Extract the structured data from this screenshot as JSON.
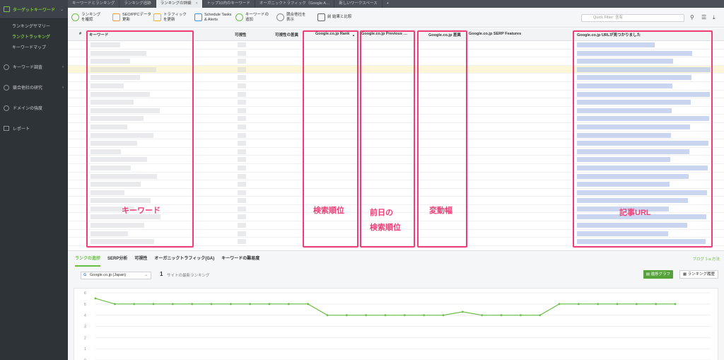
{
  "sidebar": {
    "section_label": "ターゲットキーワード",
    "sub_items": [
      "ランキングサマリー",
      "ランクトラッキング",
      "キーワードマップ"
    ],
    "active_sub": 1,
    "items": [
      "キーワード調査",
      "競合他社の研究",
      "ドメインの強度",
      "レポート"
    ]
  },
  "tabs": [
    "キーワードとランキング",
    "ランキング追跡",
    "ランキングの詳細",
    "トップ10内のキーワード",
    "オーガニックトラフィック（Google A…",
    "新しいワークスペース"
  ],
  "active_tab": 2,
  "toolbar": {
    "buttons": [
      "ランキング\nを確認",
      "SEO/PPCデータ\n更新",
      "トラフィック\nを更新",
      "Schedule Tasks\n& Alerts",
      "キーワードの\n追加",
      "競合他社を\n表示",
      "前 結果と比較"
    ],
    "filter_placeholder": "Quick Filter: 含有"
  },
  "grid": {
    "headers": [
      "#",
      "キーワード",
      "可視性",
      "可視性の差異",
      "Google.co.jp Rank",
      "Google.co.jp Previous …",
      "Google.co.jp 差異",
      "Google.co.jp SERP Features",
      "Google.co.jp URLが見つかりました"
    ],
    "sorted_column": "Google.co.jp Rank",
    "row_count": 25,
    "highlighted_row": 3
  },
  "annotations": [
    "キーワード",
    "検索順位",
    "前日の\n検索順位",
    "変動幅",
    "記事URL"
  ],
  "bottom": {
    "tabs": [
      "ランクの進捗",
      "SERP分析",
      "可視性",
      "オーガニックトラフィック(GA)",
      "キーワードの難易度"
    ],
    "active_tab": 0,
    "link_text": "ブログ 1-a 方法",
    "engine_select": "Google.co.jp (Japan)",
    "site_count": "1",
    "site_count_label": "サイトの最新ランキング",
    "graph_button": "進捗グラフ",
    "history_button": "ランキング履歴"
  },
  "chart_data": {
    "type": "line",
    "y_ticks": [
      "6",
      "5",
      "4",
      "3",
      "2",
      "1",
      "0"
    ],
    "ylim": [
      6,
      0
    ],
    "values": [
      5.5,
      5,
      5,
      5,
      5,
      5,
      5,
      5,
      5,
      5,
      5,
      5,
      4,
      4,
      4,
      4,
      4,
      4,
      4,
      4.3,
      4,
      4,
      4,
      4,
      5,
      5,
      5,
      5,
      5,
      5,
      5
    ],
    "color": "#6bbf45"
  }
}
